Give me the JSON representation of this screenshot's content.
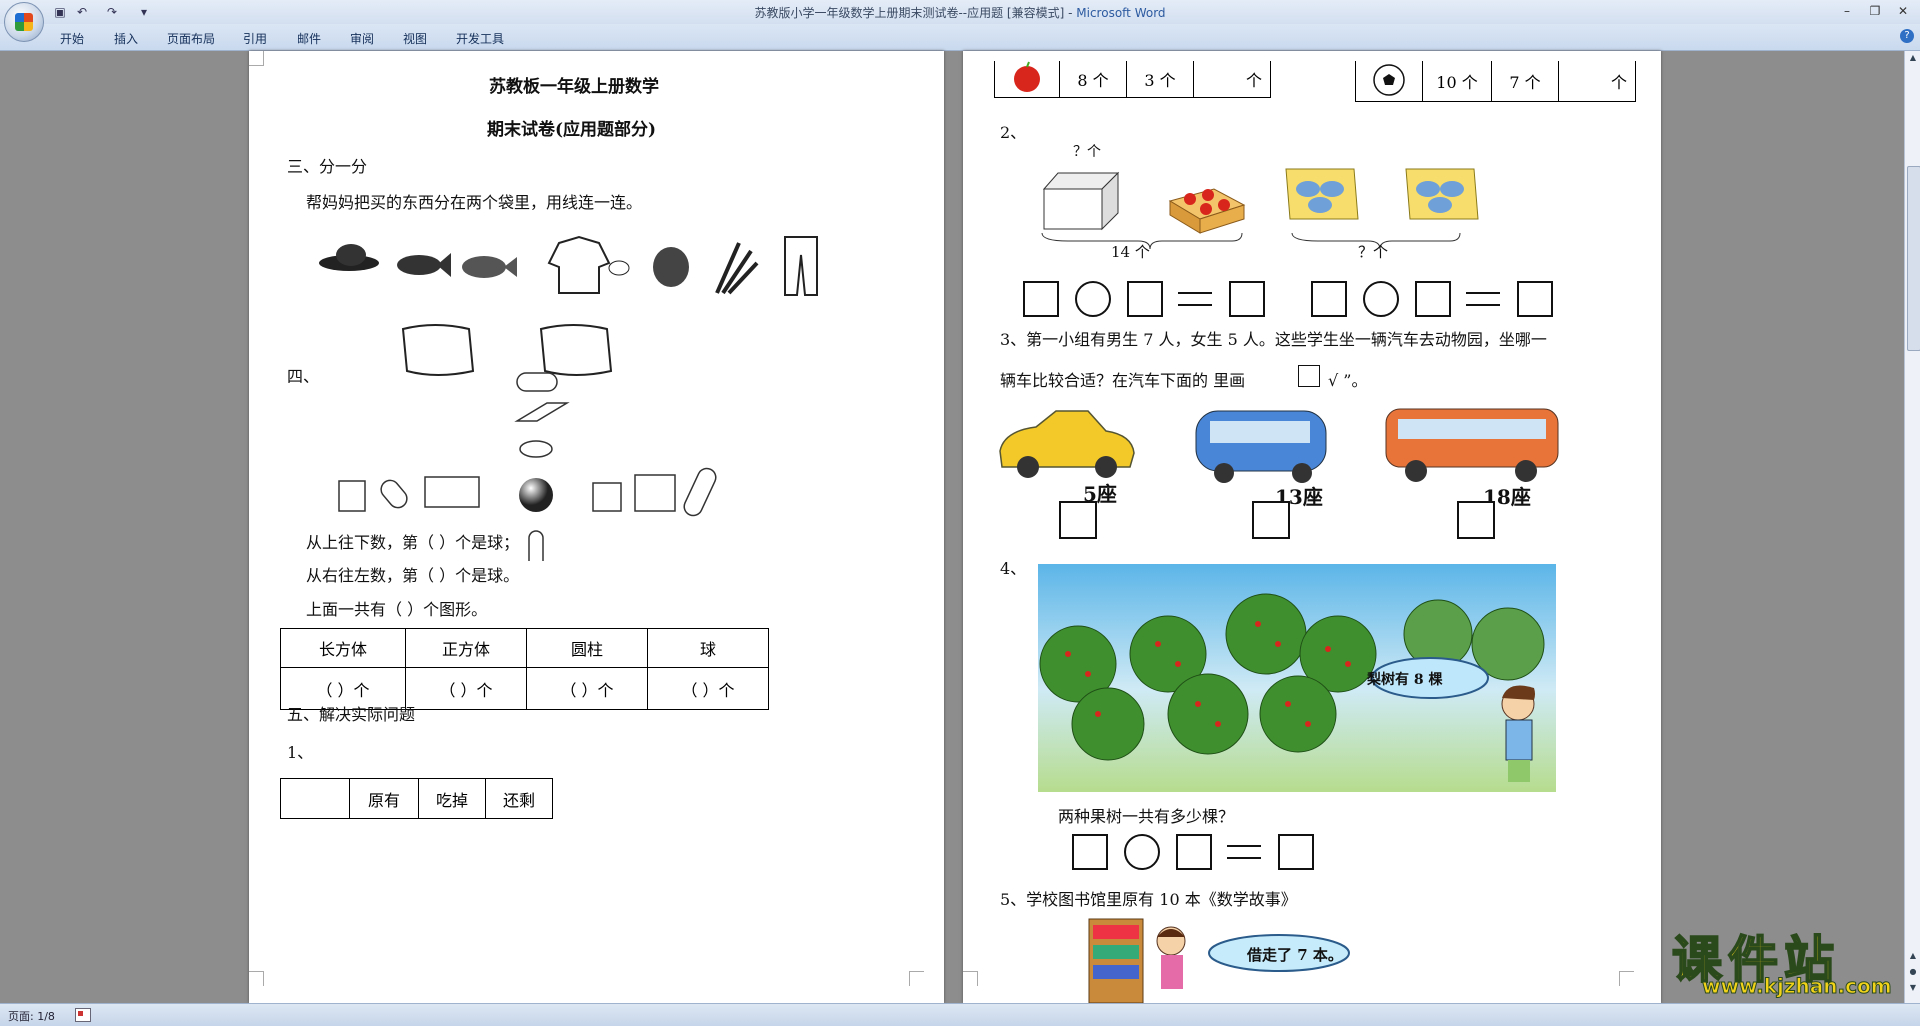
{
  "window": {
    "title": "苏教版小学一年级数学上册期末测试卷--应用题 [兼容模式]",
    "app_name": "Microsoft Word",
    "title_sep": " - "
  },
  "ribbon": {
    "tabs": [
      "开始",
      "插入",
      "页面布局",
      "引用",
      "邮件",
      "审阅",
      "视图",
      "开发工具"
    ]
  },
  "status": {
    "page": "页面: 1/8"
  },
  "watermark": {
    "main": "课件站",
    "url": "www.kjzhan.com"
  },
  "page1": {
    "title": "苏教板一年级上册数学",
    "subtitle": "期末试卷(应用题部分)",
    "s3": "三、分一分",
    "s3_desc": "帮妈妈把买的东西分在两个袋里，用线连一连。",
    "s4": "四、",
    "q_top": "从上往下数，第（      ）个是球；",
    "q_right": "从右往左数，第（      ）个是球。",
    "q_total": "上面一共有（      ）个图形。",
    "shape_table": {
      "headers": [
        "长方体",
        "正方体",
        "圆柱",
        "球"
      ],
      "cell": "（      ）个"
    },
    "s5": "五、解决实际问题",
    "q1": "1、",
    "eat_table": [
      "原有",
      "吃掉",
      "还剩"
    ]
  },
  "page2": {
    "top_table_left": {
      "a": "8 个",
      "b": "3 个",
      "c": "个"
    },
    "top_table_right": {
      "a": "10 个",
      "b": "7 个",
      "c": "个"
    },
    "q2": "2、",
    "q2_q": "？个",
    "q2_14": "14 个",
    "q2_q2": "？个",
    "q3_line1": "3、第一小组有男生 7 人，女生 5 人。这些学生坐一辆汽车去动物园，坐哪一",
    "q3_line2a": "辆车比较合适？在汽车下面的    里画",
    "q3_line2b": "√ ”。",
    "seats": [
      "5座",
      "13座",
      "18座"
    ],
    "q4": "4、",
    "q4_bubble": "梨树有 8 棵",
    "q4_ask": "两种果树一共有多少棵？",
    "q5": "5、学校图书馆里原有 10 本《数学故事》",
    "q5_bubble": "借走了 7 本。"
  }
}
